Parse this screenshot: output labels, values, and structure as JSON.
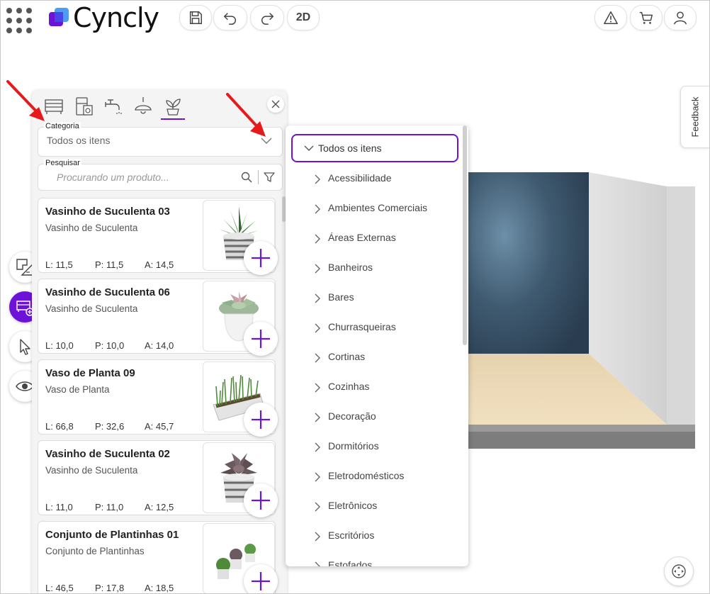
{
  "app": {
    "name": "Cyncly"
  },
  "toolbar": {
    "view_mode": "2D"
  },
  "feedback": {
    "label": "Feedback"
  },
  "panel": {
    "category": {
      "label": "Categoria",
      "value": "Todos os itens"
    },
    "search": {
      "label": "Pesquisar",
      "placeholder": "Procurando um produto..."
    },
    "products": [
      {
        "title": "Vasinho de Suculenta 03",
        "subtitle": "Vasinho de Suculenta",
        "l": "L: 11,5",
        "p": "P: 11,5",
        "a": "A: 14,5"
      },
      {
        "title": "Vasinho de Suculenta 06",
        "subtitle": "Vasinho de Suculenta",
        "l": "L: 10,0",
        "p": "P: 10,0",
        "a": "A: 14,0"
      },
      {
        "title": "Vaso de Planta 09",
        "subtitle": "Vaso de Planta",
        "l": "L: 66,8",
        "p": "P: 32,6",
        "a": "A: 45,7"
      },
      {
        "title": "Vasinho de Suculenta 02",
        "subtitle": "Vasinho de Suculenta",
        "l": "L: 11,0",
        "p": "P: 11,0",
        "a": "A: 12,5"
      },
      {
        "title": "Conjunto de Plantinhas 01",
        "subtitle": "Conjunto de Plantinhas",
        "l": "L: 46,5",
        "p": "P: 17,8",
        "a": "A: 18,5"
      }
    ]
  },
  "dropdown": {
    "selected": "Todos os itens",
    "items": [
      "Acessibilidade",
      "Ambientes Comerciais",
      "Áreas Externas",
      "Banheiros",
      "Bares",
      "Churrasqueiras",
      "Cortinas",
      "Cozinhas",
      "Decoração",
      "Dormitórios",
      "Eletrodomésticos",
      "Eletrônicos",
      "Escritórios",
      "Estofados"
    ]
  },
  "colors": {
    "accent": "#6d12d8",
    "annotation": "#e8191b"
  }
}
